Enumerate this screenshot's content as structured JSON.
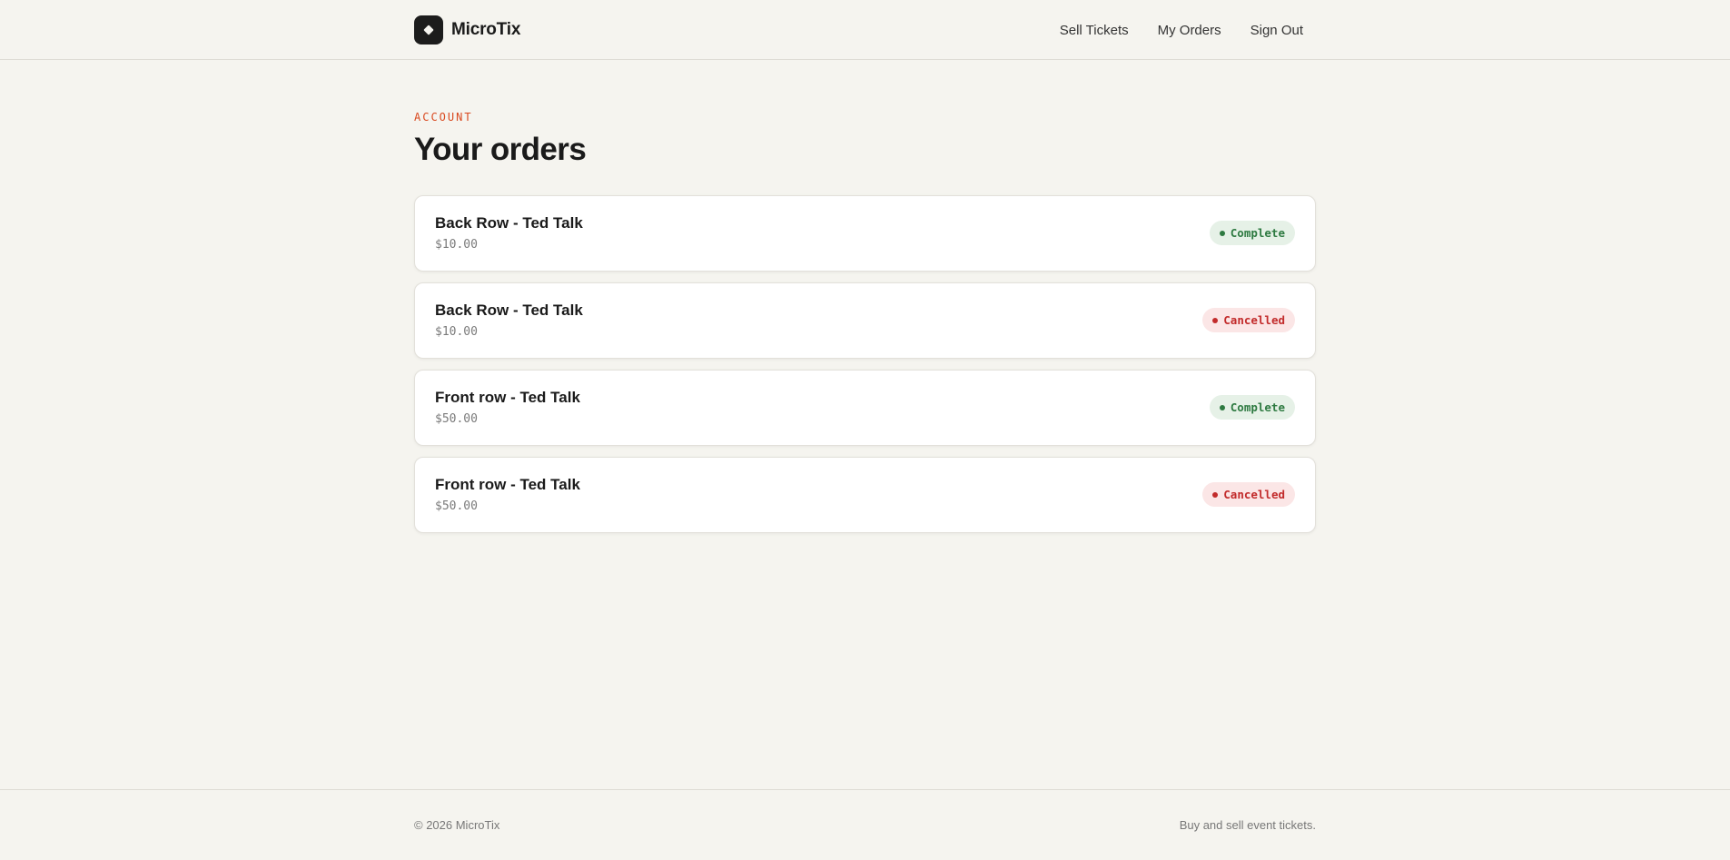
{
  "header": {
    "brand_name": "MicroTix",
    "nav": [
      {
        "label": "Sell Tickets"
      },
      {
        "label": "My Orders"
      },
      {
        "label": "Sign Out"
      }
    ]
  },
  "main": {
    "eyebrow": "ACCOUNT",
    "title": "Your orders",
    "orders": [
      {
        "title": "Back Row - Ted Talk",
        "price": "$10.00",
        "status": "Complete"
      },
      {
        "title": "Back Row - Ted Talk",
        "price": "$10.00",
        "status": "Cancelled"
      },
      {
        "title": "Front row - Ted Talk",
        "price": "$50.00",
        "status": "Complete"
      },
      {
        "title": "Front row - Ted Talk",
        "price": "$50.00",
        "status": "Cancelled"
      }
    ]
  },
  "footer": {
    "copyright": "© 2026 MicroTix",
    "tagline": "Buy and sell event tickets."
  },
  "colors": {
    "background": "#f5f4ef",
    "accent": "#d9481e",
    "complete": "#2e7a41",
    "cancelled": "#c22b2b"
  },
  "icons": {
    "logo": "diamond-logo-icon",
    "status_dot": "dot-icon"
  }
}
